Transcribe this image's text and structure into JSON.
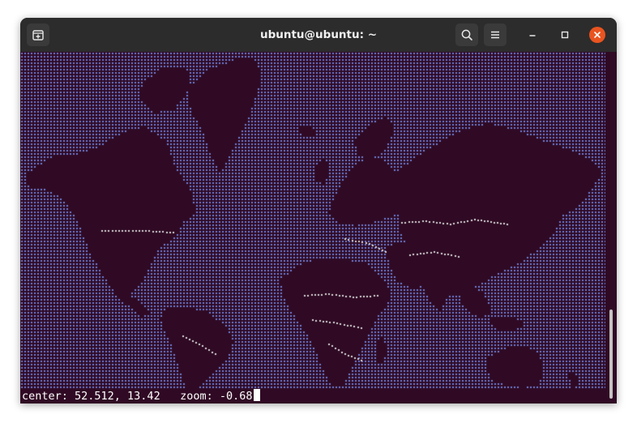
{
  "window": {
    "title": "ubuntu@ubuntu: ~"
  },
  "titlebar": {
    "new_tab_icon": "new-tab-icon",
    "search_icon": "search-icon",
    "menu_icon": "hamburger-menu-icon",
    "minimize_icon": "minimize-icon",
    "maximize_icon": "maximize-icon",
    "close_icon": "close-icon"
  },
  "terminal": {
    "status": {
      "center_label": "center: ",
      "center_value": "52.512, 13.42",
      "zoom_label": "   zoom: ",
      "zoom_value": "-0.68"
    },
    "colors": {
      "background": "#300a24",
      "ocean": "#6f7fd6",
      "land": "#000000",
      "border": "#d9d9d9",
      "close_button": "#e95420"
    }
  }
}
